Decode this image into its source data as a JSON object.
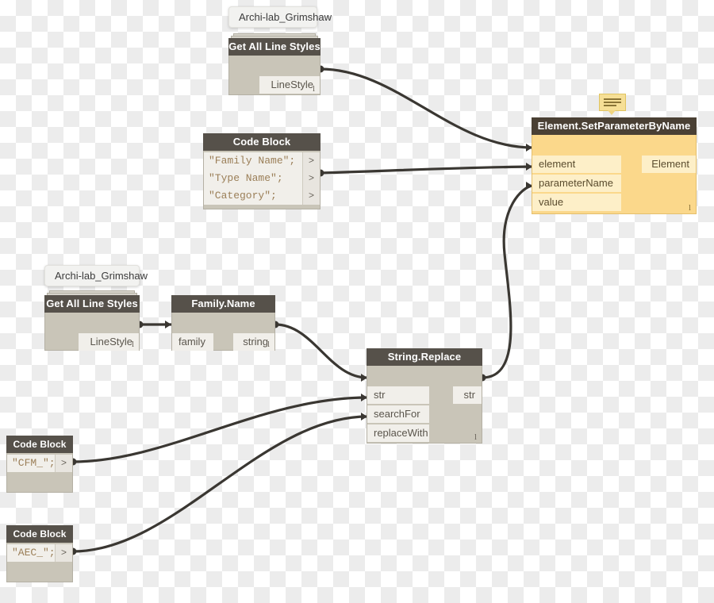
{
  "app": {
    "name": "Dynamo Graph Canvas",
    "background": "transparent-checkerboard"
  },
  "colors": {
    "node_header": "#56514a",
    "node_body": "#c9c5b8",
    "port_background": "#f1efea",
    "wire": "#3a3732",
    "amber_header": "#4a4034",
    "amber_body": "#fbd88b",
    "amber_port": "#fdefc8",
    "code_string": "#9b7f58",
    "note_bubble": "#f6df96"
  },
  "nodes": [
    {
      "id": "get-all-line-styles-1",
      "title": "Get All Line Styles",
      "package_label": "Archi-lab_Grimshaw",
      "inputs": [],
      "outputs": [
        "LineStyle"
      ],
      "lacing": "l"
    },
    {
      "id": "code-block-1",
      "title": "Code Block",
      "lines": [
        "\"Family Name\";",
        "\"Type Name\";",
        "\"Category\";"
      ],
      "outputs": [
        ">",
        ">",
        ">"
      ],
      "lacing": ""
    },
    {
      "id": "element-set-parameter-by-name",
      "title": "Element.SetParameterByName",
      "inputs": [
        "element",
        "parameterName",
        "value"
      ],
      "outputs": [
        "Element"
      ],
      "lacing": "l",
      "state": "selected-amber",
      "note_icon": "note-bubble-icon"
    },
    {
      "id": "get-all-line-styles-2",
      "title": "Get All Line Styles",
      "package_label": "Archi-lab_Grimshaw",
      "inputs": [],
      "outputs": [
        "LineStyle"
      ],
      "lacing": "l"
    },
    {
      "id": "family-name",
      "title": "Family.Name",
      "inputs": [
        "family"
      ],
      "outputs": [
        "string"
      ],
      "lacing": "l"
    },
    {
      "id": "string-replace",
      "title": "String.Replace",
      "inputs": [
        "str",
        "searchFor",
        "replaceWith"
      ],
      "outputs": [
        "str"
      ],
      "lacing": "l"
    },
    {
      "id": "code-block-cfm",
      "title": "Code Block",
      "lines": [
        "\"CFM_\";"
      ],
      "outputs": [
        ">"
      ],
      "lacing": ""
    },
    {
      "id": "code-block-aec",
      "title": "Code Block",
      "lines": [
        "\"AEC_\";"
      ],
      "outputs": [
        ">"
      ],
      "lacing": ""
    }
  ],
  "connections": [
    {
      "from": "get-all-line-styles-1.LineStyle",
      "to": "element-set-parameter-by-name.element"
    },
    {
      "from": "code-block-1.out2",
      "to": "element-set-parameter-by-name.parameterName"
    },
    {
      "from": "string-replace.str",
      "to": "element-set-parameter-by-name.value"
    },
    {
      "from": "get-all-line-styles-2.LineStyle",
      "to": "family-name.family"
    },
    {
      "from": "family-name.string",
      "to": "string-replace.str"
    },
    {
      "from": "code-block-cfm.out1",
      "to": "string-replace.searchFor"
    },
    {
      "from": "code-block-aec.out1",
      "to": "string-replace.replaceWith"
    }
  ]
}
